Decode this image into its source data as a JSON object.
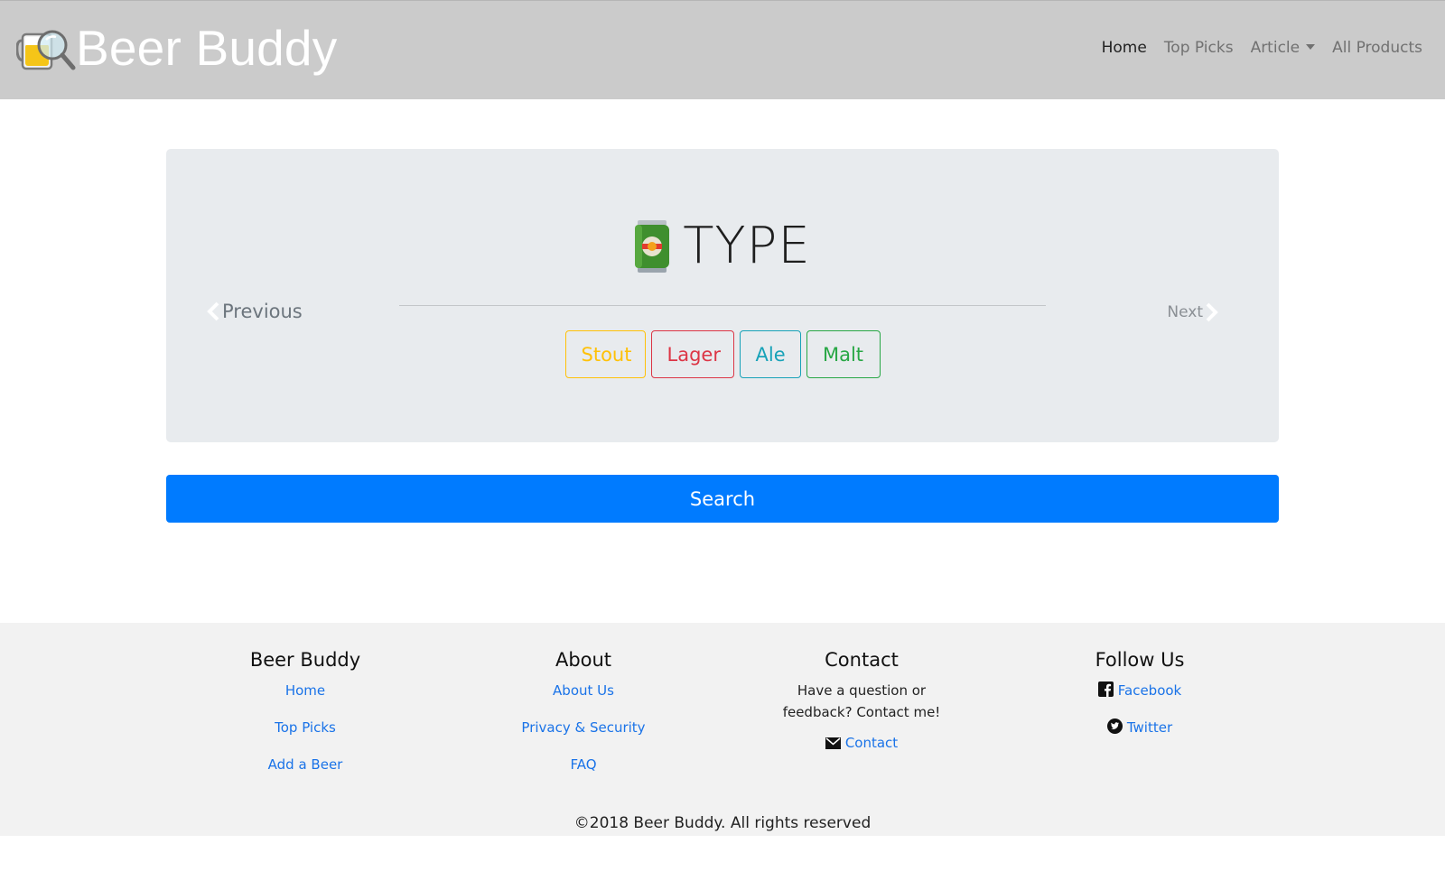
{
  "navbar": {
    "brand": "Beer Buddy",
    "links": {
      "home": "Home",
      "top_picks": "Top Picks",
      "article": "Article",
      "all_products": "All Products"
    }
  },
  "carousel": {
    "heading": "TYPE",
    "heading_icon": "beer-can-icon",
    "previous": "Previous",
    "next": "Next",
    "options": [
      {
        "label": "Stout",
        "color": "#ffc107"
      },
      {
        "label": "Lager",
        "color": "#dc3545"
      },
      {
        "label": "Ale",
        "color": "#17a2b8"
      },
      {
        "label": "Malt",
        "color": "#28a745"
      }
    ]
  },
  "search": {
    "label": "Search",
    "color": "#007bff"
  },
  "footer": {
    "columns": [
      {
        "title": "Beer Buddy",
        "links": [
          "Home",
          "Top Picks",
          "Add a Beer"
        ]
      },
      {
        "title": "About",
        "links": [
          "About Us",
          "Privacy & Security",
          "FAQ"
        ]
      },
      {
        "title": "Contact",
        "text": "Have a question or feedback? Contact me!",
        "link": "Contact",
        "link_icon": "envelope-icon"
      },
      {
        "title": "Follow Us",
        "links": [
          {
            "label": "Facebook",
            "icon": "facebook-icon"
          },
          {
            "label": "Twitter",
            "icon": "twitter-icon"
          }
        ]
      }
    ],
    "copyright": "©2018 Beer Buddy. All rights reserved"
  }
}
